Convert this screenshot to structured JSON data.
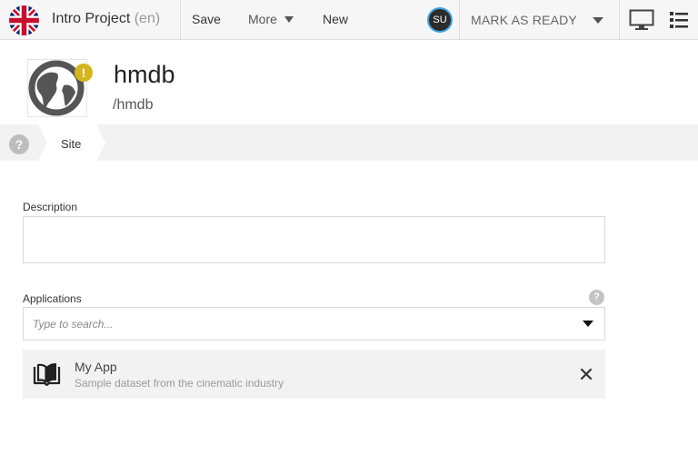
{
  "topbar": {
    "project_title": "Intro Project",
    "project_lang": "(en)",
    "save_label": "Save",
    "more_label": "More",
    "new_label": "New",
    "user_initials": "SU",
    "mark_ready_label": "MARK AS READY"
  },
  "header": {
    "site_title": "hmdb",
    "site_path": "/hmdb",
    "status_badge": "!"
  },
  "tabs": {
    "help": "?",
    "site_label": "Site"
  },
  "form": {
    "description_label": "Description",
    "applications_label": "Applications",
    "applications_help": "?",
    "search_placeholder": "Type to search...",
    "applications": [
      {
        "name": "My App",
        "description": "Sample dataset from the cinematic industry"
      }
    ]
  },
  "colors": {
    "accent": "#3fa7e0",
    "warning": "#d4b51c"
  }
}
